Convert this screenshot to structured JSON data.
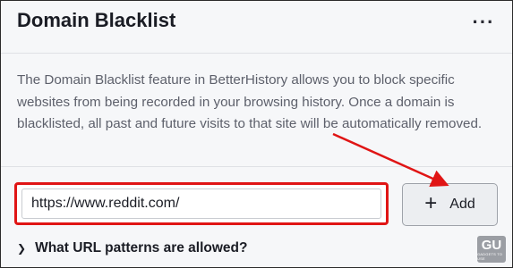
{
  "header": {
    "title": "Domain Blacklist",
    "more_icon": "ellipsis-icon",
    "more_glyph": "···"
  },
  "description": "The Domain Blacklist feature in BetterHistory allows you to block specific websites from being recorded in your browsing history. Once a domain is blacklisted, all past and future visits to that site will be automatically removed.",
  "domain_input": {
    "value": "https://www.reddit.com/"
  },
  "add_button": {
    "icon": "plus-icon",
    "glyph": "+",
    "label": "Add"
  },
  "url_patterns": {
    "icon": "chevron-right-icon",
    "glyph": "❯",
    "label": "What URL patterns are allowed?"
  },
  "watermark": {
    "mark": "GU",
    "text": "GADGETS TO USE"
  },
  "colors": {
    "highlight": "#e01515",
    "background": "#f6f7f9",
    "text": "#1a1c24",
    "muted_text": "#5d606b"
  }
}
